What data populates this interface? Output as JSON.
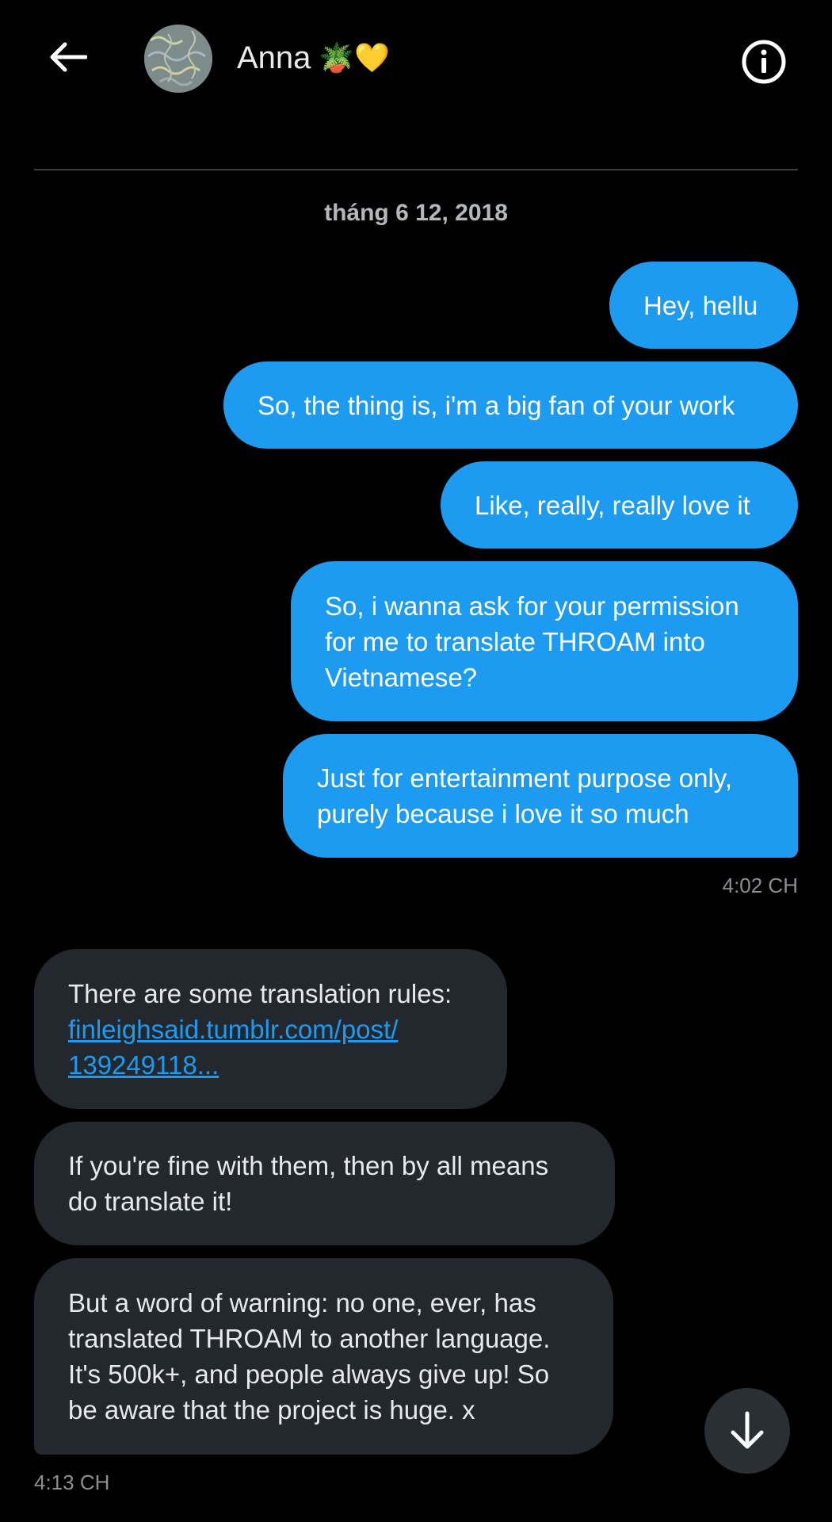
{
  "header": {
    "contact_name": "Anna",
    "name_emojis": "🪴💛"
  },
  "conversation": {
    "date_separator": "tháng 6 12, 2018",
    "outgoing": [
      {
        "text": "Hey, hellu"
      },
      {
        "text": "So, the thing is, i'm a big fan of your work"
      },
      {
        "text": "Like, really, really love it"
      },
      {
        "lines": [
          "So, i wanna ask for your permission",
          "for me to translate THROAM into",
          "Vietnamese?"
        ]
      },
      {
        "lines": [
          "Just for entertainment purpose only,",
          "purely because i love it so much"
        ]
      }
    ],
    "outgoing_time": "4:02 CH",
    "incoming": [
      {
        "text": "There are some translation rules:",
        "link_lines": [
          "finleighsaid.tumblr.com/post/",
          "139249118..."
        ]
      },
      {
        "lines": [
          "If you're fine with them, then by all means",
          "do translate it!"
        ]
      },
      {
        "lines": [
          "But a word of warning: no one, ever, has",
          "translated THROAM to another language.",
          "It's 500k+, and people always give up! So",
          "be aware that the project is huge. x"
        ]
      }
    ],
    "incoming_time": "4:13 CH"
  },
  "icons": {
    "back": "back-arrow-icon",
    "info": "info-icon",
    "scroll": "arrow-down-icon"
  },
  "colors": {
    "background": "#000000",
    "outgoing_bubble": "#1d9bf0",
    "incoming_bubble": "#22282e",
    "link": "#1d9bf0",
    "timestamp": "#8b9096"
  }
}
